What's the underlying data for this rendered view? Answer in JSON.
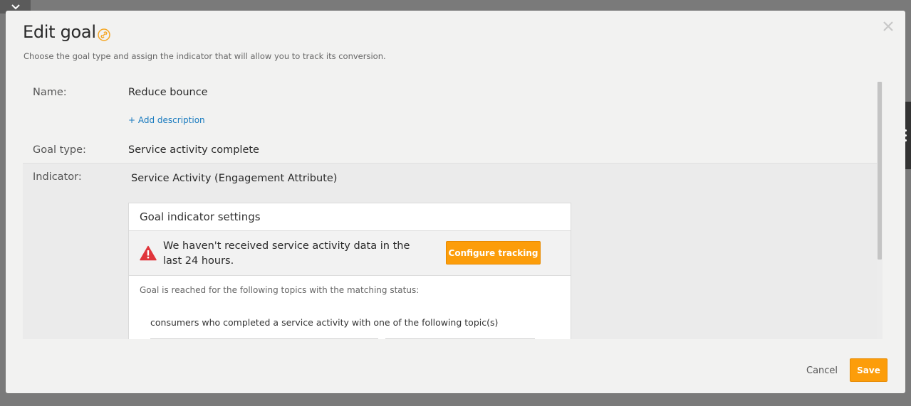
{
  "modal": {
    "title": "Edit goal",
    "subtitle": "Choose the goal type and assign the indicator that will allow you to track its conversion."
  },
  "form": {
    "name_label": "Name:",
    "name_value": "Reduce bounce",
    "add_description": "+ Add description",
    "goal_type_label": "Goal type:",
    "goal_type_value": "Service activity complete",
    "indicator_label": "Indicator:",
    "indicator_value": "Service Activity (Engagement Attribute)"
  },
  "panel": {
    "title": "Goal indicator settings",
    "warning": "We haven't received service activity data in the last 24 hours.",
    "configure_button": "Configure tracking",
    "goal_reached_text": "Goal is reached for the following topics with the matching status:",
    "consumers_text": "consumers who completed a service activity with one of the following topic(s)"
  },
  "footer": {
    "cancel": "Cancel",
    "save": "Save"
  },
  "colors": {
    "accent": "#fc9d0a",
    "link": "#1a7bbf",
    "warning": "#e0353b"
  },
  "icons": [
    "chevron-down-icon",
    "link-icon",
    "close-icon",
    "warning-icon",
    "more-vertical-icon"
  ]
}
